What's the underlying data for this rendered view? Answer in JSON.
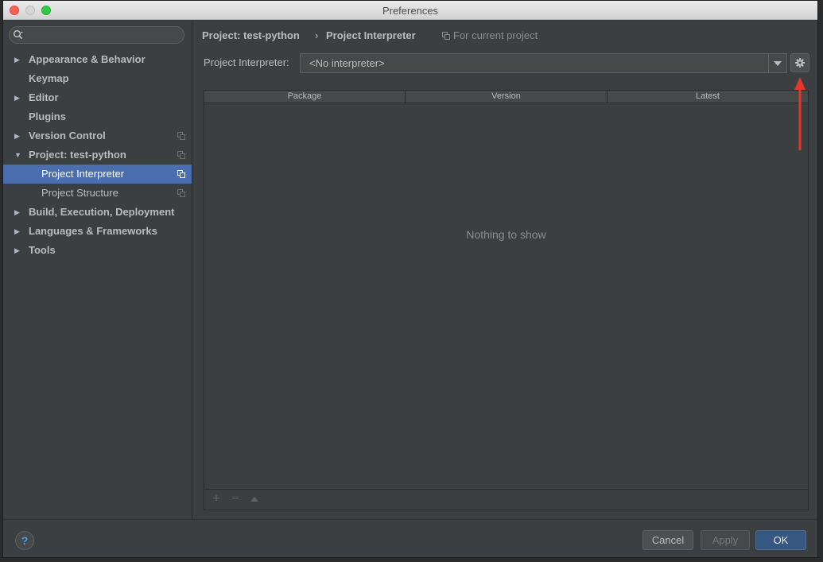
{
  "window": {
    "title": "Preferences"
  },
  "sidebar": {
    "items": [
      {
        "label": "Appearance & Behavior",
        "expandable": true,
        "bold": true
      },
      {
        "label": "Keymap",
        "expandable": false,
        "bold": true
      },
      {
        "label": "Editor",
        "expandable": true,
        "bold": true
      },
      {
        "label": "Plugins",
        "expandable": false,
        "bold": true
      },
      {
        "label": "Version Control",
        "expandable": true,
        "bold": true
      },
      {
        "label": "Project: test-python",
        "expandable": true,
        "expanded": true,
        "bold": true
      },
      {
        "label": "Project Interpreter",
        "child": true,
        "selected": true
      },
      {
        "label": "Project Structure",
        "child": true
      },
      {
        "label": "Build, Execution, Deployment",
        "expandable": true,
        "bold": true
      },
      {
        "label": "Languages & Frameworks",
        "expandable": true,
        "bold": true
      },
      {
        "label": "Tools",
        "expandable": true,
        "bold": true
      }
    ]
  },
  "breadcrumb": {
    "project": "Project: test-python",
    "separator": "›",
    "current": "Project Interpreter",
    "scope": "For current project"
  },
  "interpreter": {
    "label": "Project Interpreter:",
    "value": "<No interpreter>"
  },
  "packages": {
    "columns": [
      "Package",
      "Version",
      "Latest"
    ],
    "empty_text": "Nothing to show"
  },
  "footer": {
    "help": "?",
    "cancel": "Cancel",
    "apply": "Apply",
    "ok": "OK"
  },
  "colors": {
    "selection": "#4b6eaf",
    "annotation_arrow": "#e8352a",
    "ok_button": "#365880"
  }
}
